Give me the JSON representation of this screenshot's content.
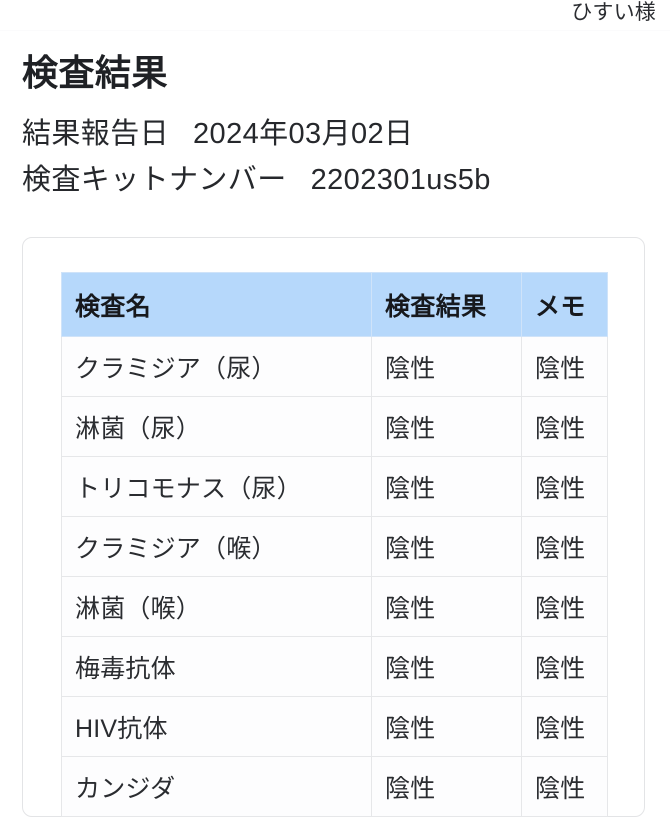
{
  "topbar": {
    "user_name": "ひすい様"
  },
  "page": {
    "title": "検査結果"
  },
  "meta": {
    "report_date_label": "結果報告日",
    "report_date_value": "2024年03月02日",
    "kit_number_label": "検査キットナンバー",
    "kit_number_value": "2202301us5b"
  },
  "table": {
    "headers": {
      "name": "検査名",
      "result": "検査結果",
      "memo": "メモ"
    },
    "rows": [
      {
        "name": "クラミジア（尿）",
        "result": "陰性",
        "memo": "陰性"
      },
      {
        "name": "淋菌（尿）",
        "result": "陰性",
        "memo": "陰性"
      },
      {
        "name": "トリコモナス（尿）",
        "result": "陰性",
        "memo": "陰性"
      },
      {
        "name": "クラミジア（喉）",
        "result": "陰性",
        "memo": "陰性"
      },
      {
        "name": "淋菌（喉）",
        "result": "陰性",
        "memo": "陰性"
      },
      {
        "name": "梅毒抗体",
        "result": "陰性",
        "memo": "陰性"
      },
      {
        "name": "HIV抗体",
        "result": "陰性",
        "memo": "陰性"
      },
      {
        "name": "カンジダ",
        "result": "陰性",
        "memo": "陰性"
      }
    ]
  },
  "colors": {
    "header_blue": "#b6d8fb",
    "card_border": "#e3e4e6",
    "cell_border": "#e6e7e9",
    "text": "#2a2c30"
  }
}
